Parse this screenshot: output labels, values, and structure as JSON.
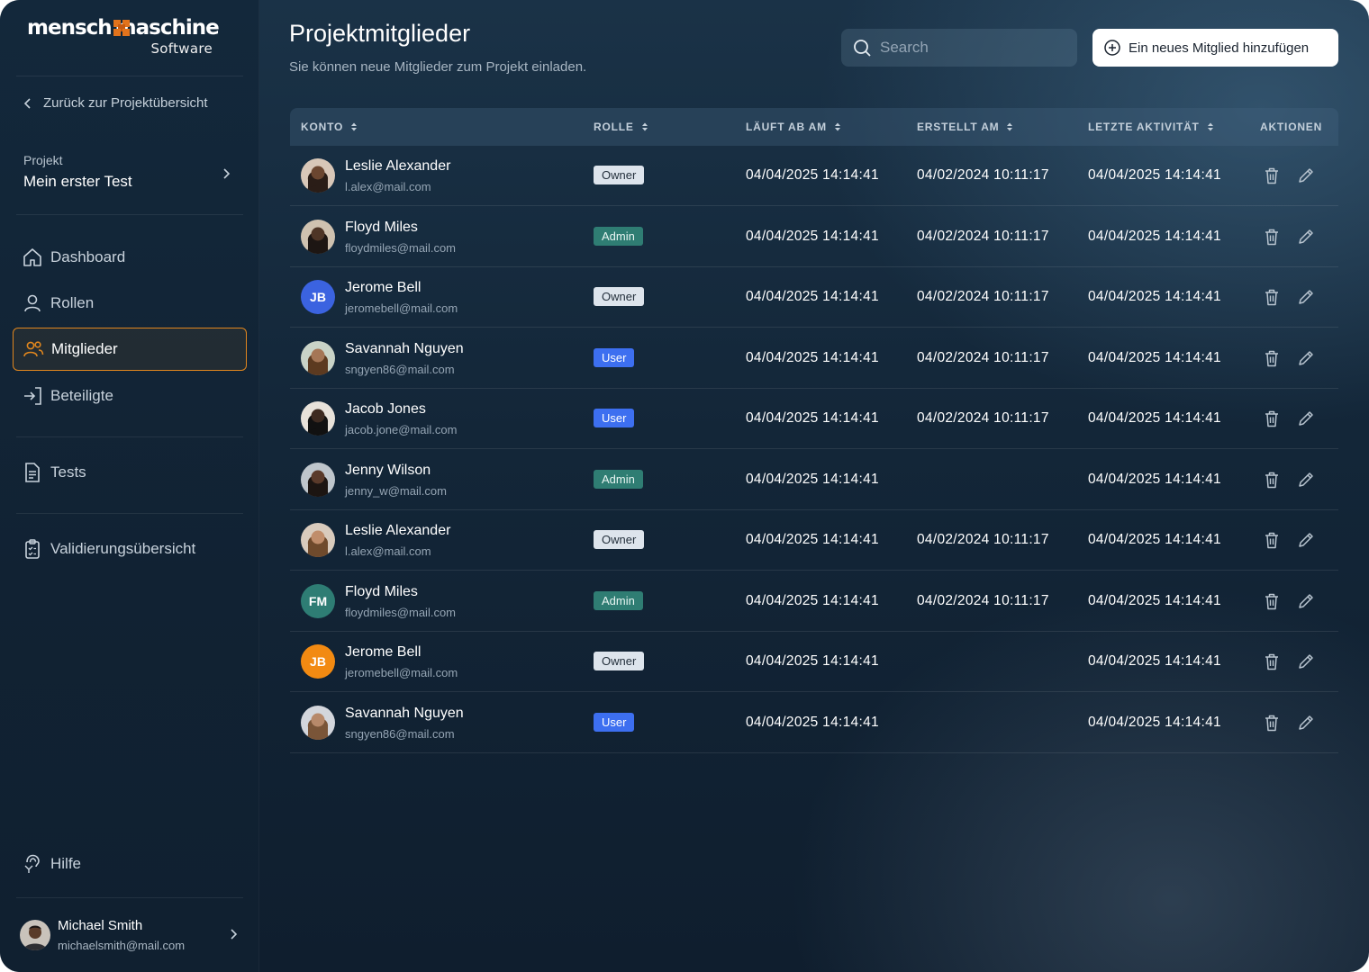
{
  "brand": {
    "name_left": "mensch",
    "name_right": "maschine",
    "sub": "Software",
    "accent": "#e2731c"
  },
  "sidebar": {
    "back_label": "Zurück zur Projektübersicht",
    "project_label": "Projekt",
    "project_name": "Mein erster Test",
    "items": [
      {
        "label": "Dashboard",
        "icon": "home-icon"
      },
      {
        "label": "Rollen",
        "icon": "person-icon"
      },
      {
        "label": "Mitglieder",
        "icon": "people-icon",
        "active": true
      },
      {
        "label": "Beteiligte",
        "icon": "login-arrow-icon"
      },
      {
        "label": "Tests",
        "icon": "document-icon"
      },
      {
        "label": "Validierungsübersicht",
        "icon": "clipboard-icon"
      },
      {
        "label": "Hilfe",
        "icon": "help-icon"
      }
    ],
    "user": {
      "name": "Michael Smith",
      "email": "michaelsmith@mail.com"
    }
  },
  "header": {
    "title": "Projektmitglieder",
    "subtitle": "Sie können neue Mitglieder zum Projekt einladen.",
    "search_placeholder": "Search",
    "add_button": "Ein neues Mitglied hinzufügen"
  },
  "table": {
    "columns": [
      "KONTO",
      "ROLLE",
      "LÄUFT AB AM",
      "ERSTELLT AM",
      "LETZTE AKTIVITÄT",
      "AKTIONEN"
    ],
    "rows": [
      {
        "name": "Leslie Alexander",
        "email": "l.alex@mail.com",
        "role": "Owner",
        "expires": "04/04/2025 14:14:41",
        "created": "04/02/2024 10:11:17",
        "last": "04/04/2025 14:14:41",
        "avatar": "photo"
      },
      {
        "name": "Floyd Miles",
        "email": "floydmiles@mail.com",
        "role": "Admin",
        "expires": "04/04/2025 14:14:41",
        "created": "04/02/2024 10:11:17",
        "last": "04/04/2025 14:14:41",
        "avatar": "photo"
      },
      {
        "name": "Jerome Bell",
        "email": "jeromebell@mail.com",
        "role": "Owner",
        "expires": "04/04/2025 14:14:41",
        "created": "04/02/2024 10:11:17",
        "last": "04/04/2025 14:14:41",
        "avatar": "JB",
        "avatar_color": "#3b63e0"
      },
      {
        "name": "Savannah Nguyen",
        "email": "sngyen86@mail.com",
        "role": "User",
        "expires": "04/04/2025 14:14:41",
        "created": "04/02/2024 10:11:17",
        "last": "04/04/2025 14:14:41",
        "avatar": "photo"
      },
      {
        "name": "Jacob Jones",
        "email": "jacob.jone@mail.com",
        "role": "User",
        "expires": "04/04/2025 14:14:41",
        "created": "04/02/2024 10:11:17",
        "last": "04/04/2025 14:14:41",
        "avatar": "photo"
      },
      {
        "name": "Jenny Wilson",
        "email": "jenny_w@mail.com",
        "role": "Admin",
        "expires": "04/04/2025 14:14:41",
        "created": "",
        "last": "04/04/2025 14:14:41",
        "avatar": "photo"
      },
      {
        "name": "Leslie Alexander",
        "email": "l.alex@mail.com",
        "role": "Owner",
        "expires": "04/04/2025 14:14:41",
        "created": "04/02/2024 10:11:17",
        "last": "04/04/2025 14:14:41",
        "avatar": "photo"
      },
      {
        "name": "Floyd Miles",
        "email": "floydmiles@mail.com",
        "role": "Admin",
        "expires": "04/04/2025 14:14:41",
        "created": "04/02/2024 10:11:17",
        "last": "04/04/2025 14:14:41",
        "avatar": "FM",
        "avatar_color": "#2e7d74"
      },
      {
        "name": "Jerome Bell",
        "email": "jeromebell@mail.com",
        "role": "Owner",
        "expires": "04/04/2025 14:14:41",
        "created": "",
        "last": "04/04/2025 14:14:41",
        "avatar": "JB",
        "avatar_color": "#f28a12"
      },
      {
        "name": "Savannah Nguyen",
        "email": "sngyen86@mail.com",
        "role": "User",
        "expires": "04/04/2025 14:14:41",
        "created": "",
        "last": "04/04/2025 14:14:41",
        "avatar": "photo"
      }
    ]
  }
}
